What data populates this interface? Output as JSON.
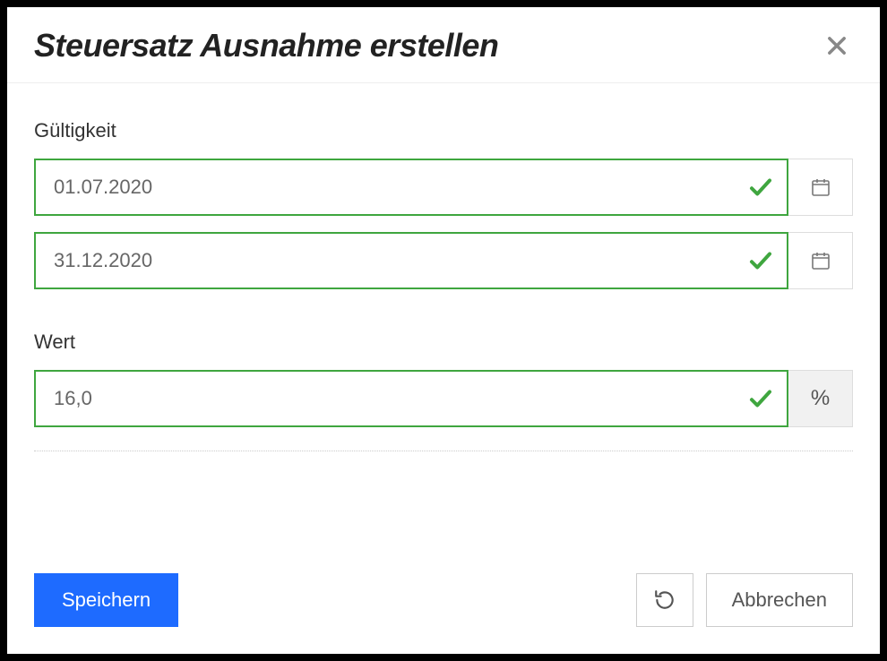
{
  "modal": {
    "title": "Steuersatz Ausnahme erstellen"
  },
  "form": {
    "validity_label": "Gültigkeit",
    "date_from": "01.07.2020",
    "date_to": "31.12.2020",
    "value_label": "Wert",
    "value": "16,0",
    "value_unit": "%"
  },
  "footer": {
    "save": "Speichern",
    "cancel": "Abbrechen"
  },
  "icons": {
    "close": "close-icon",
    "check": "check-icon",
    "calendar": "calendar-icon",
    "undo": "undo-icon"
  }
}
